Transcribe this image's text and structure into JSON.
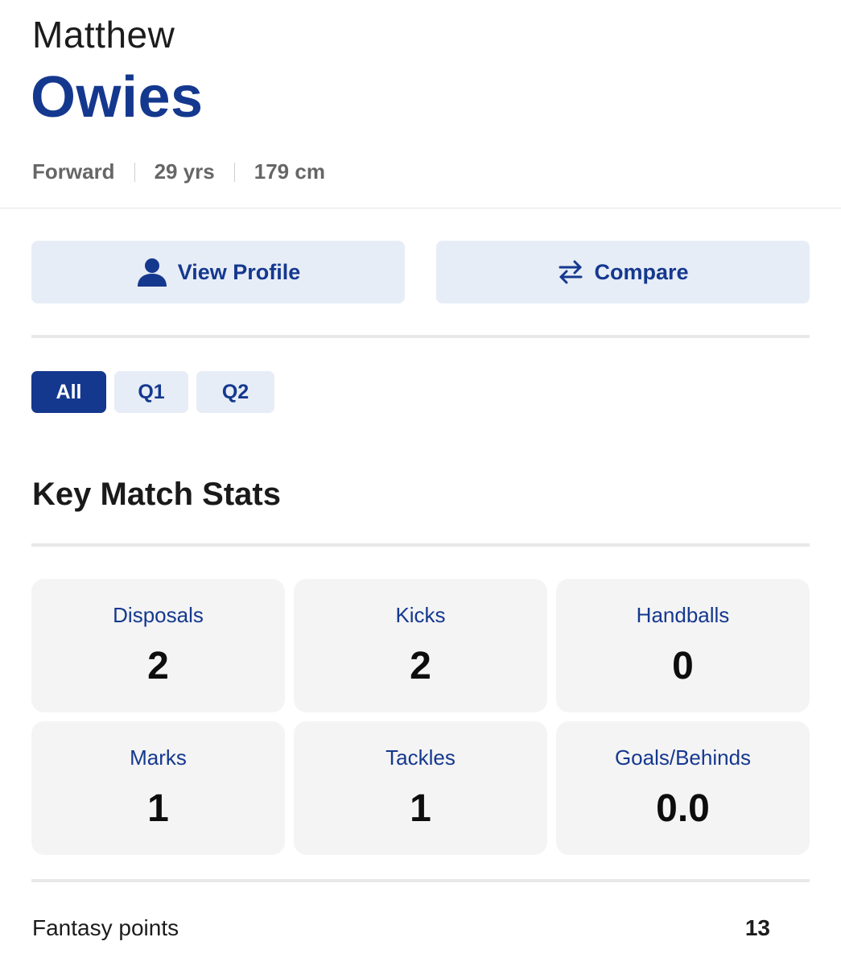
{
  "player": {
    "first_name": "Matthew",
    "last_name": "Owies",
    "position": "Forward",
    "age": "29 yrs",
    "height": "179 cm"
  },
  "actions": {
    "view_profile": "View Profile",
    "compare": "Compare"
  },
  "tabs": [
    {
      "label": "All",
      "active": true
    },
    {
      "label": "Q1",
      "active": false
    },
    {
      "label": "Q2",
      "active": false
    }
  ],
  "section_title": "Key Match Stats",
  "stats": [
    {
      "label": "Disposals",
      "value": "2"
    },
    {
      "label": "Kicks",
      "value": "2"
    },
    {
      "label": "Handballs",
      "value": "0"
    },
    {
      "label": "Marks",
      "value": "1"
    },
    {
      "label": "Tackles",
      "value": "1"
    },
    {
      "label": "Goals/Behinds",
      "value": "0.0"
    }
  ],
  "fantasy": {
    "label": "Fantasy points",
    "value": "13"
  },
  "colors": {
    "brand_blue": "#15388f",
    "button_bg": "#e7edf6",
    "card_bg": "#f4f4f4"
  },
  "icons": {
    "profile": "person-icon",
    "compare": "swap-arrows-icon"
  }
}
